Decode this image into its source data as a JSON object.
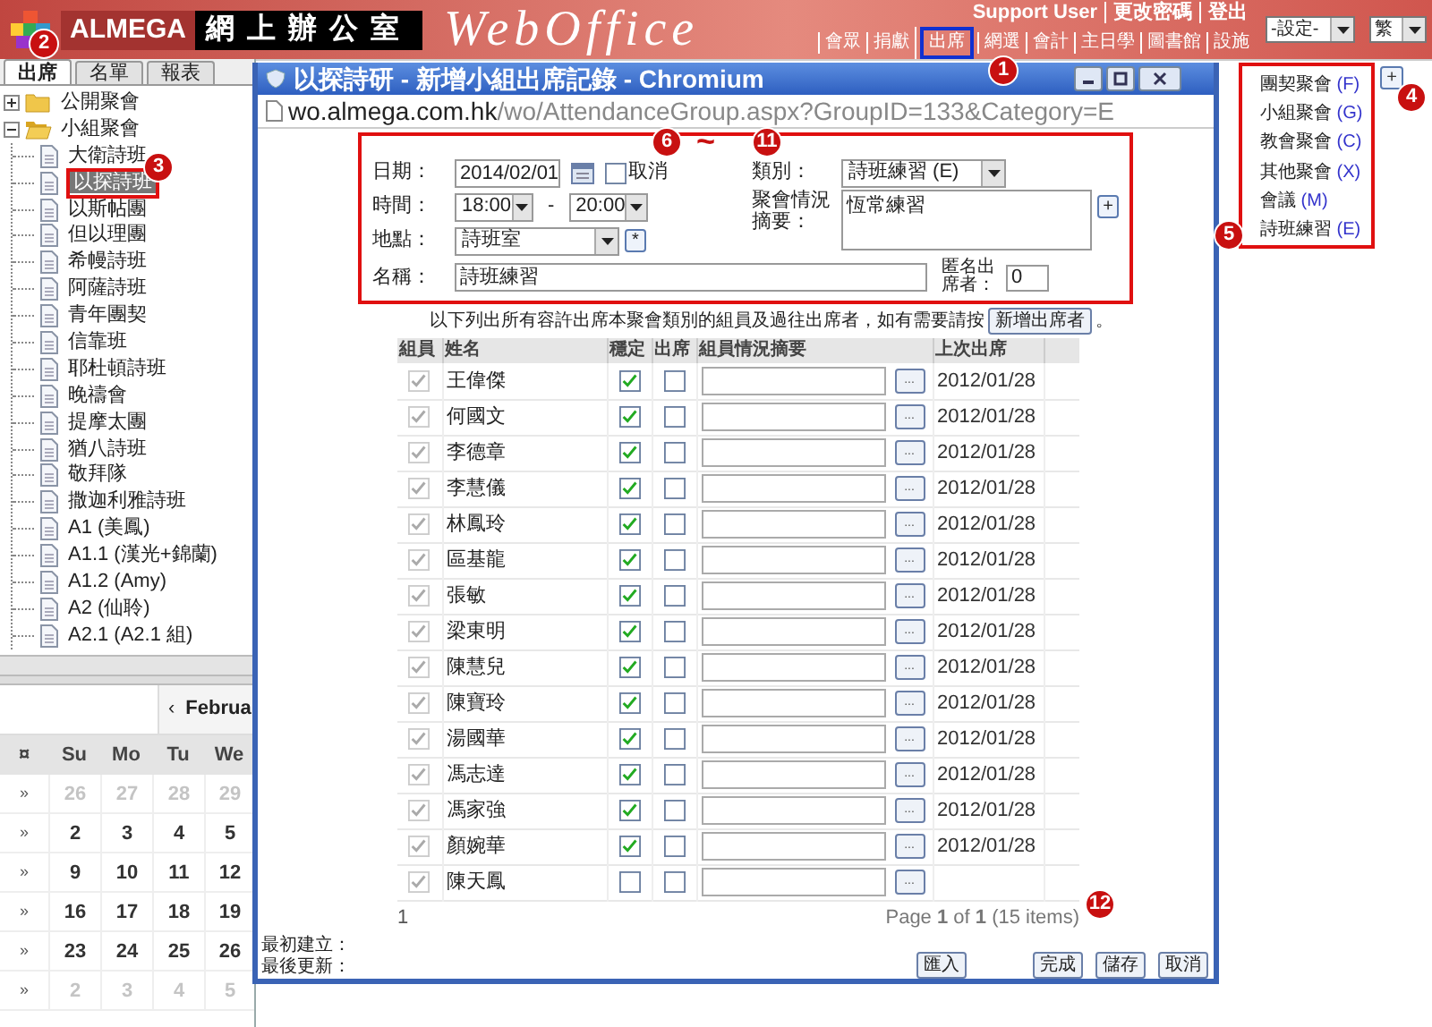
{
  "header": {
    "brand": "ALMEGA",
    "brand_sub": "網上辦公室",
    "product": "WebOffice",
    "user_links": [
      "Support User",
      "更改密碼",
      "登出"
    ],
    "nav_links": [
      "會眾",
      "捐獻",
      "出席",
      "網選",
      "會計",
      "主日學",
      "圖書館",
      "設施"
    ],
    "settings_select": "-設定-",
    "language_select": "繁"
  },
  "left_tabs": [
    {
      "label": "出席",
      "selected": true
    },
    {
      "label": "名單",
      "selected": false
    },
    {
      "label": "報表",
      "selected": false
    }
  ],
  "tree": [
    {
      "label": "公開聚會",
      "expanded": false
    },
    {
      "label": "小組聚會",
      "expanded": true,
      "children": [
        {
          "label": "大衛詩班",
          "selected": false
        },
        {
          "label": "以探詩班",
          "selected": true
        },
        {
          "label": "以斯帖團",
          "selected": false
        },
        {
          "label": "但以理團",
          "selected": false
        },
        {
          "label": "希幔詩班",
          "selected": false
        },
        {
          "label": "阿薩詩班",
          "selected": false
        },
        {
          "label": "青年團契",
          "selected": false
        },
        {
          "label": "信靠班",
          "selected": false
        },
        {
          "label": "耶杜頓詩班",
          "selected": false
        },
        {
          "label": "晚禱會",
          "selected": false
        },
        {
          "label": "提摩太團",
          "selected": false
        },
        {
          "label": "猶八詩班",
          "selected": false
        },
        {
          "label": "敬拜隊",
          "selected": false
        },
        {
          "label": "撒迦利雅詩班",
          "selected": false
        },
        {
          "label": "A1 (美鳳)",
          "selected": false
        },
        {
          "label": "A1.1 (漢光+錦蘭)",
          "selected": false
        },
        {
          "label": "A1.2 (Amy)",
          "selected": false
        },
        {
          "label": "A2 (仙聆)",
          "selected": false
        },
        {
          "label": "A2.1 (A2.1 組)",
          "selected": false
        }
      ]
    }
  ],
  "calendar": {
    "prev": "‹",
    "month": "Februa",
    "corner": "¤",
    "weekdays": [
      "Su",
      "Mo",
      "Tu",
      "We"
    ],
    "weeks": [
      {
        "selector": "»",
        "days": [
          {
            "text": "26",
            "muted": true
          },
          {
            "text": "27",
            "muted": true
          },
          {
            "text": "28",
            "muted": true
          },
          {
            "text": "29",
            "muted": true
          }
        ]
      },
      {
        "selector": "»",
        "days": [
          {
            "text": "2",
            "muted": false
          },
          {
            "text": "3",
            "muted": false
          },
          {
            "text": "4",
            "muted": false
          },
          {
            "text": "5",
            "muted": false
          }
        ]
      },
      {
        "selector": "»",
        "days": [
          {
            "text": "9",
            "muted": false
          },
          {
            "text": "10",
            "muted": false
          },
          {
            "text": "11",
            "muted": false
          },
          {
            "text": "12",
            "muted": false
          }
        ]
      },
      {
        "selector": "»",
        "days": [
          {
            "text": "16",
            "muted": false
          },
          {
            "text": "17",
            "muted": false
          },
          {
            "text": "18",
            "muted": false
          },
          {
            "text": "19",
            "muted": false
          }
        ]
      },
      {
        "selector": "»",
        "days": [
          {
            "text": "23",
            "muted": false
          },
          {
            "text": "24",
            "muted": false
          },
          {
            "text": "25",
            "muted": false
          },
          {
            "text": "26",
            "muted": false
          }
        ]
      },
      {
        "selector": "»",
        "days": [
          {
            "text": "2",
            "muted": true
          },
          {
            "text": "3",
            "muted": true
          },
          {
            "text": "4",
            "muted": true
          },
          {
            "text": "5",
            "muted": true
          }
        ]
      }
    ]
  },
  "dialog": {
    "title": "以探詩研 - 新增小組出席記錄 - Chromium",
    "url_host": "wo.almega.com.hk",
    "url_path": "/wo/AttendanceGroup.aspx?GroupID=133&Category=E",
    "date": {
      "label": "日期：",
      "value": "2014/02/01"
    },
    "cancel": {
      "label": "取消",
      "checked": false
    },
    "category": {
      "label": "類別：",
      "value": "詩班練習 (E)"
    },
    "time": {
      "label": "時間：",
      "from": "18:00",
      "separator": "-",
      "to": "20:00"
    },
    "summary": {
      "label": "聚會情況摘要：",
      "value": "恆常練習",
      "button": "+"
    },
    "location": {
      "label": "地點：",
      "value": "詩班室",
      "button": "*"
    },
    "name": {
      "label": "名稱：",
      "value": "詩班練習"
    },
    "anonymous": {
      "label": "匿名出席者：",
      "value": "0"
    },
    "instruction": "以下列出所有容許出席本聚會類別的組員及過往出席者，如有需要請按",
    "add_button": "新增出席者",
    "instruction_end": "。",
    "columns": [
      "組員",
      "姓名",
      "穩定",
      "出席",
      "組員情況摘要",
      "上次出席"
    ],
    "rows": [
      {
        "name": "王偉傑",
        "member": true,
        "stable": true,
        "present": false,
        "button": "...",
        "last": "2012/01/28"
      },
      {
        "name": "何國文",
        "member": true,
        "stable": true,
        "present": false,
        "button": "...",
        "last": "2012/01/28"
      },
      {
        "name": "李德章",
        "member": true,
        "stable": true,
        "present": false,
        "button": "...",
        "last": "2012/01/28"
      },
      {
        "name": "李慧儀",
        "member": true,
        "stable": true,
        "present": false,
        "button": "...",
        "last": "2012/01/28"
      },
      {
        "name": "林鳳玲",
        "member": true,
        "stable": true,
        "present": false,
        "button": "...",
        "last": "2012/01/28"
      },
      {
        "name": "區基龍",
        "member": true,
        "stable": true,
        "present": false,
        "button": "...",
        "last": "2012/01/28"
      },
      {
        "name": "張敏",
        "member": true,
        "stable": true,
        "present": false,
        "button": "...",
        "last": "2012/01/28"
      },
      {
        "name": "梁東明",
        "member": true,
        "stable": true,
        "present": false,
        "button": "...",
        "last": "2012/01/28"
      },
      {
        "name": "陳慧兒",
        "member": true,
        "stable": true,
        "present": false,
        "button": "...",
        "last": "2012/01/28"
      },
      {
        "name": "陳寶玲",
        "member": true,
        "stable": true,
        "present": false,
        "button": "...",
        "last": "2012/01/28"
      },
      {
        "name": "湯國華",
        "member": true,
        "stable": true,
        "present": false,
        "button": "...",
        "last": "2012/01/28"
      },
      {
        "name": "馮志達",
        "member": true,
        "stable": true,
        "present": false,
        "button": "...",
        "last": "2012/01/28"
      },
      {
        "name": "馮家強",
        "member": true,
        "stable": true,
        "present": false,
        "button": "...",
        "last": "2012/01/28"
      },
      {
        "name": "顏婉華",
        "member": true,
        "stable": true,
        "present": false,
        "button": "...",
        "last": "2012/01/28"
      },
      {
        "name": "陳天鳳",
        "member": true,
        "stable": false,
        "present": false,
        "button": "..."
      }
    ],
    "page_number": "1",
    "pager": "Page **1** of **1** (15 items)",
    "created_label": "最初建立：",
    "updated_label": "最後更新：",
    "buttons": [
      {
        "label": "匯入",
        "kind": "import"
      },
      {
        "label": "完成",
        "kind": "action"
      },
      {
        "label": "儲存",
        "kind": "action"
      },
      {
        "label": "取消",
        "kind": "action"
      }
    ]
  },
  "panel_button": "+",
  "category_menu": [
    {
      "name": "團契聚會",
      "code": "(F)"
    },
    {
      "name": "小組聚會",
      "code": "(G)"
    },
    {
      "name": "教會聚會",
      "code": "(C)"
    },
    {
      "name": "其他聚會",
      "code": "(X)"
    },
    {
      "name": "會議",
      "code": "(M)"
    },
    {
      "name": "詩班練習",
      "code": "(E)"
    }
  ],
  "annotations": [
    {
      "text": "1",
      "kind": "badge"
    },
    {
      "text": "2",
      "kind": "badge"
    },
    {
      "text": "3",
      "kind": "badge"
    },
    {
      "text": "4",
      "kind": "badge"
    },
    {
      "text": "5",
      "kind": "badge"
    },
    {
      "text": "6",
      "kind": "badge"
    },
    {
      "text": "~",
      "kind": "tilde"
    },
    {
      "text": "11",
      "kind": "badge"
    },
    {
      "text": "12",
      "kind": "badge"
    }
  ]
}
